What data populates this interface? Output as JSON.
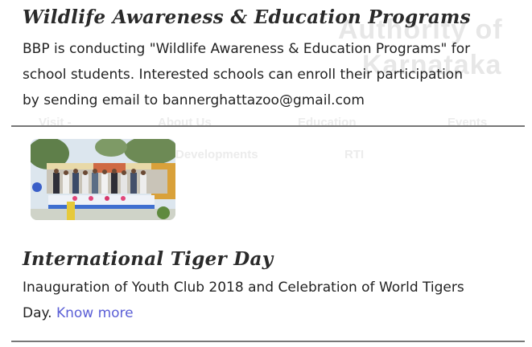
{
  "watermark": {
    "org_line1": "Authority of",
    "org_line2": "Karnataka",
    "nav_items": [
      "Visit -",
      "About Us",
      "Education",
      "Events",
      "Developments",
      "RTI"
    ]
  },
  "programs": {
    "title": "Wildlife Awareness & Education Programs",
    "line1": "BBP is conducting \"Wildlife Awareness & Education Programs\" for",
    "line2": "school students. Interested schools can enroll their participation",
    "line3": "by sending email to bannerghattazoo@gmail.com"
  },
  "tiger_day": {
    "title": "International Tiger Day",
    "line1": "Inauguration of Youth Club 2018 and Celebration of World Tigers",
    "line2_text": "Day.",
    "link_label": "Know more"
  },
  "colors": {
    "link": "#5b5fd6",
    "divider": "#777777",
    "watermark": "#e7e7e7"
  }
}
